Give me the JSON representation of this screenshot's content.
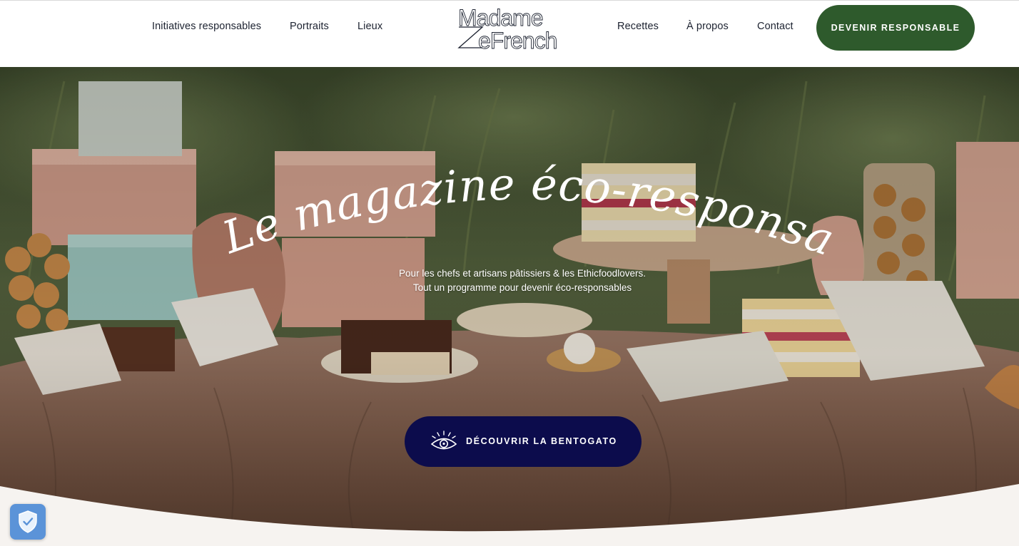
{
  "header": {
    "nav_left": [
      "Initiatives responsables",
      "Portraits",
      "Lieux"
    ],
    "logo_top": "Madame",
    "logo_bottom": "eFrench",
    "nav_right": [
      "Recettes",
      "À propos",
      "Contact"
    ],
    "cta_label": "DEVENIR RESPONSABLE"
  },
  "hero": {
    "title": "Le magazine éco-responsable",
    "subtitle_line1": "Pour les chefs et artisans pâtissiers & les Ethicfoodlovers.",
    "subtitle_line2": "Tout un programme pour devenir éco-responsables",
    "button_label": "DÉCOUVRIR LA BENTOGATO",
    "button_icon": "eye-icon",
    "package_brand": "Madame eFrench"
  },
  "privacy_badge": {
    "icon": "shield-check-icon"
  },
  "colors": {
    "cta_green": "#2e5a2c",
    "button_navy": "#0c0c4c",
    "nav_text": "#1c2230",
    "shield_blue": "#5b93d8",
    "page_bottom": "#f6f3f0"
  }
}
